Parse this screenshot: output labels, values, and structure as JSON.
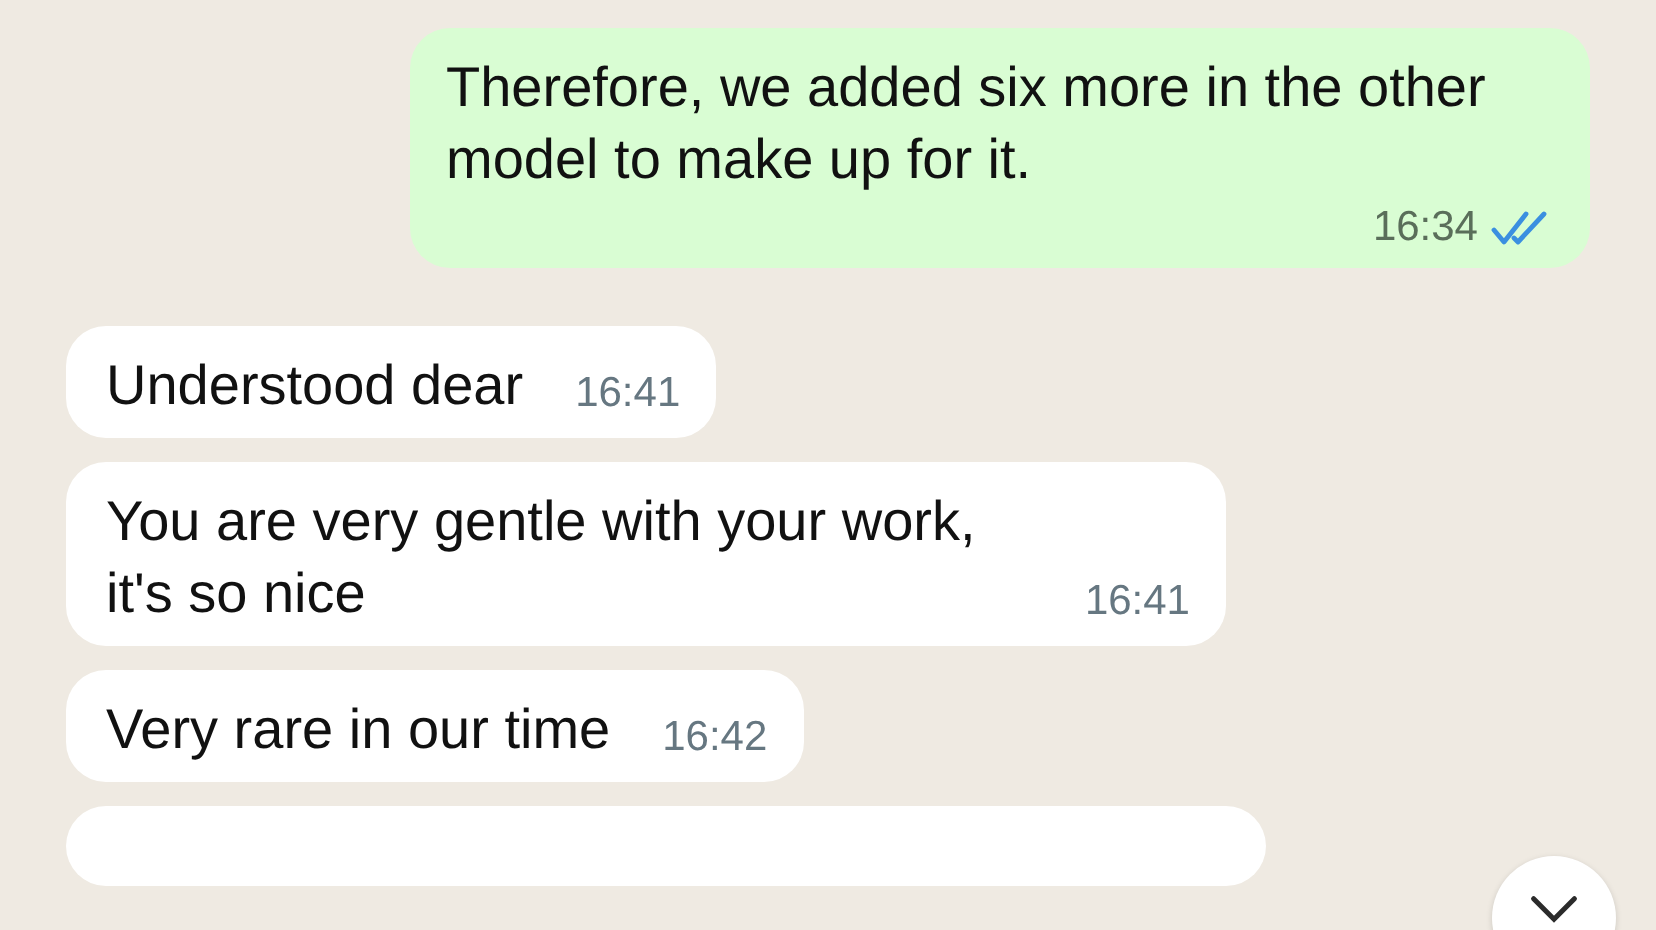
{
  "messages": [
    {
      "kind": "outgoing",
      "text": "Therefore, we added six more in the other model to make up for it.",
      "time": "16:34",
      "read": true
    },
    {
      "kind": "incoming",
      "text": "Understood dear",
      "time": "16:41"
    },
    {
      "kind": "incoming",
      "text": "You are very gentle with your work, it's so nice",
      "time": "16:41"
    },
    {
      "kind": "incoming",
      "text": "Very rare in our time",
      "time": "16:42"
    }
  ]
}
